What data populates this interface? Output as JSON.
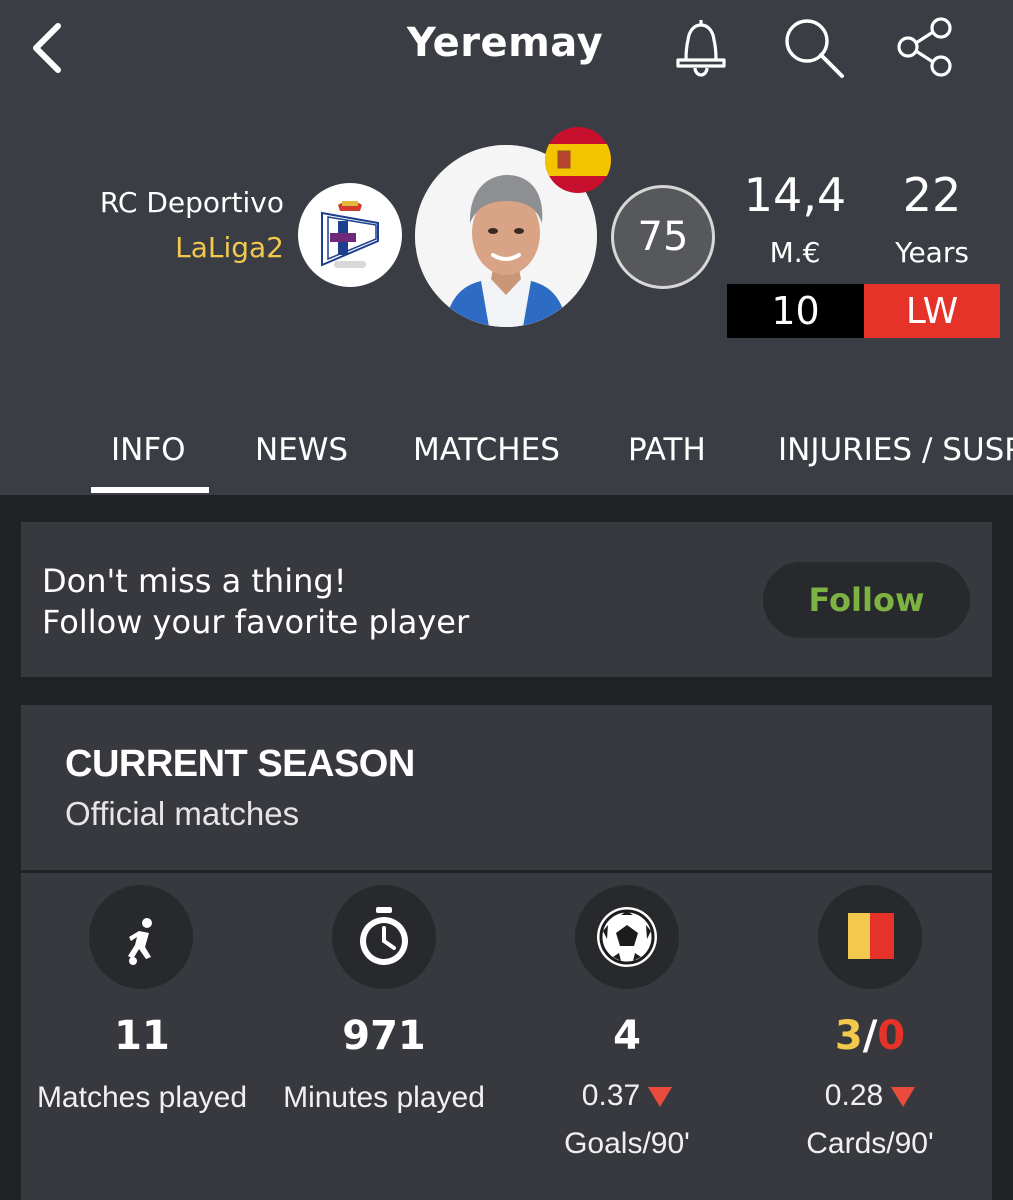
{
  "header": {
    "title": "Yeremay",
    "icons": [
      "back-icon",
      "bell-icon",
      "search-icon",
      "share-icon"
    ]
  },
  "player": {
    "club": "RC Deportivo",
    "league": "LaLiga2",
    "rating": "75",
    "value": "14,4",
    "value_unit": "M.€",
    "age": "22",
    "age_unit": "Years",
    "number": "10",
    "position": "LW",
    "nationality_flag": "spain-flag-icon"
  },
  "tabs": [
    "INFO",
    "NEWS",
    "MATCHES",
    "PATH",
    "INJURIES / SUSP"
  ],
  "active_tab": "INFO",
  "follow": {
    "line1": "Don't miss a thing!",
    "line2": "Follow your favorite player",
    "button": "Follow"
  },
  "season": {
    "title": "CURRENT SEASON",
    "subtitle": "Official matches",
    "stats": [
      {
        "value": "11",
        "label": "Matches played",
        "icon": "player-running-icon"
      },
      {
        "value": "971",
        "label": "Minutes played",
        "icon": "stopwatch-icon"
      },
      {
        "value": "4",
        "per90": "0.37",
        "label": "Goals/90'",
        "icon": "soccer-ball-icon"
      },
      {
        "yellow": "3",
        "sep": "/",
        "red": "0",
        "per90": "0.28",
        "label": "Cards/90'",
        "icon": "cards-icon"
      }
    ]
  },
  "colors": {
    "header_bg": "#3a3d43",
    "page_bg": "#202226",
    "card_bg": "#37393e",
    "league": "#f2c94c",
    "position": "#e5332a",
    "follow_text": "#7cb342",
    "yellow_card": "#f2c94c",
    "red_card": "#e5332a",
    "trend_down": "#ea4b3c"
  }
}
